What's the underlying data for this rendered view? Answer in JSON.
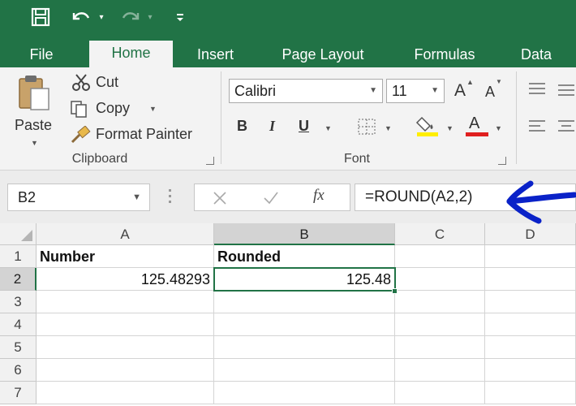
{
  "quick_access": {
    "save_icon": "save-icon",
    "undo_icon": "undo-icon",
    "redo_icon": "redo-icon",
    "customize_icon": "customize-qat-icon"
  },
  "tabs": [
    "File",
    "Home",
    "Insert",
    "Page Layout",
    "Formulas",
    "Data"
  ],
  "active_tab": "Home",
  "ribbon": {
    "clipboard": {
      "paste_label": "Paste",
      "cut_label": "Cut",
      "copy_label": "Copy",
      "format_painter_label": "Format Painter",
      "group_label": "Clipboard"
    },
    "font": {
      "font_name": "Calibri",
      "font_size": "11",
      "grow_label": "A",
      "shrink_label": "A",
      "bold_label": "B",
      "italic_label": "I",
      "underline_label": "U",
      "font_color_label": "A",
      "group_label": "Font",
      "font_color": "#e02020",
      "highlight_color": "#ffee00"
    }
  },
  "formula_bar": {
    "name_box": "B2",
    "fx_label": "fx",
    "formula": "=ROUND(A2,2)",
    "arrow_color": "#0a22c8"
  },
  "sheet": {
    "columns": [
      "A",
      "B",
      "C",
      "D"
    ],
    "rows": [
      "1",
      "2",
      "3",
      "4",
      "5",
      "6",
      "7"
    ],
    "cells": {
      "A1": "Number",
      "B1": "Rounded",
      "A2": "125.48293",
      "B2": "125.48"
    },
    "active_cell": "B2"
  },
  "colors": {
    "accent": "#217346",
    "ribbon_bg": "#f3f3f3"
  }
}
